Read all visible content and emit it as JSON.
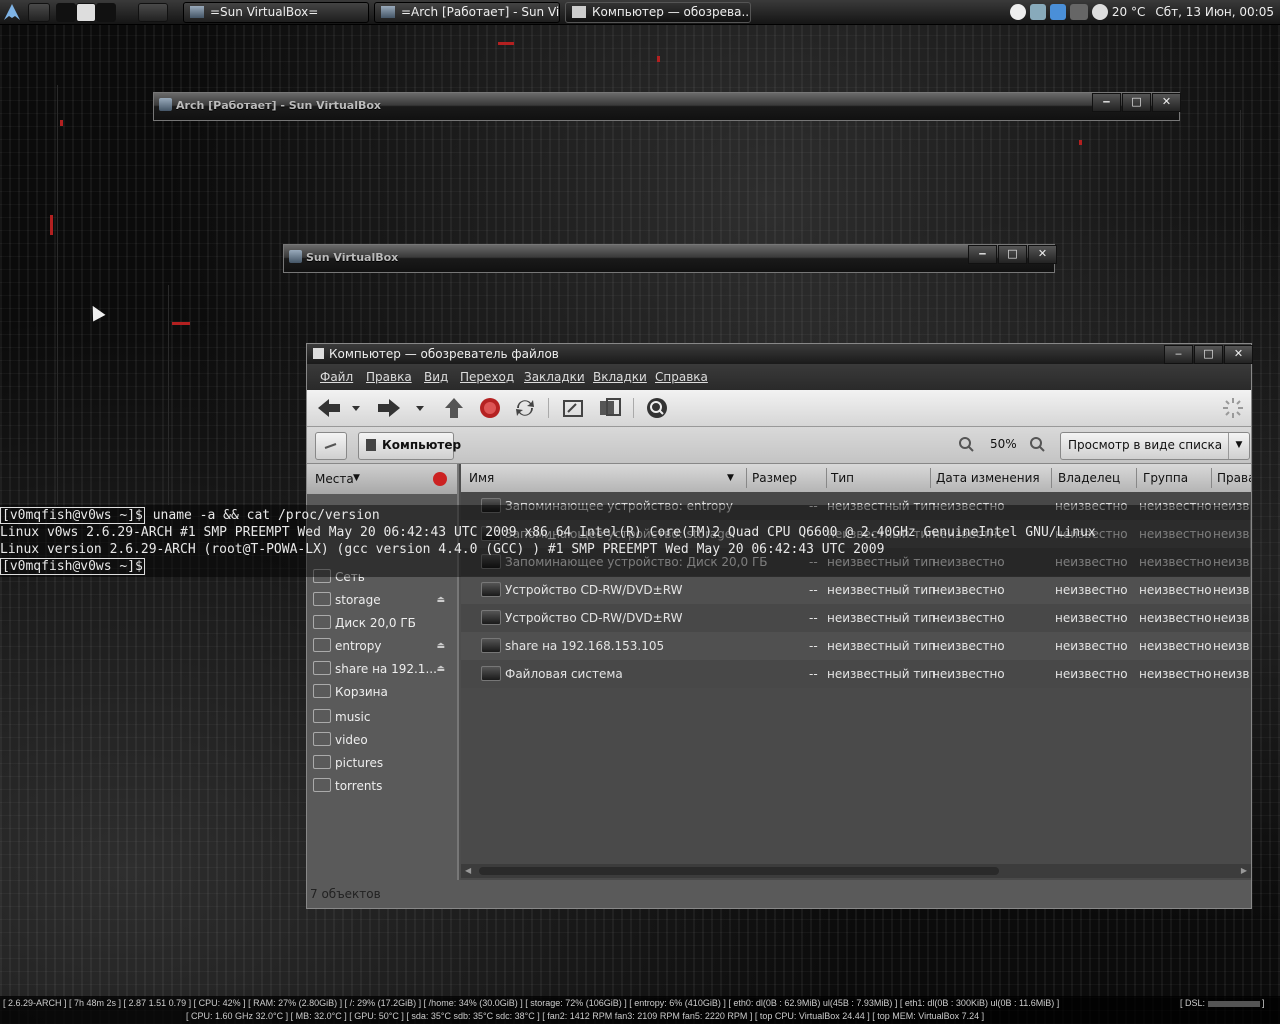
{
  "top_panel": {
    "tasks": [
      {
        "label": "=Sun VirtualBox="
      },
      {
        "label": "=Arch [Работает] - Sun Vi..."
      },
      {
        "label": "Компьютер — обозрева..."
      }
    ],
    "tray": {
      "temp": "20 °C",
      "clock": "Сбт, 13 Июн, 00:05"
    }
  },
  "shaded_windows": [
    {
      "title": "Arch [Работает] - Sun VirtualBox"
    },
    {
      "title": "Sun VirtualBox"
    }
  ],
  "window_controls": {
    "minimize": "‒",
    "maximize": "□",
    "close": "✕"
  },
  "file_manager": {
    "title": "Компьютер — обозреватель файлов",
    "menu": [
      "Файл",
      "Правка",
      "Вид",
      "Переход",
      "Закладки",
      "Вкладки",
      "Справка"
    ],
    "location_button": "Компьютер",
    "zoom": "50%",
    "view_mode": "Просмотр в виде списка",
    "sidebar_header": "Места",
    "sidebar_items": [
      {
        "label": "Сеть",
        "icon": "network-icon",
        "eject": false
      },
      {
        "label": "storage",
        "icon": "drive-icon",
        "eject": true
      },
      {
        "label": "Диск 20,0 ГБ",
        "icon": "drive-icon",
        "eject": false
      },
      {
        "label": "entropy",
        "icon": "drive-icon",
        "eject": true
      },
      {
        "label": "share на 192.1...",
        "icon": "network-share-icon",
        "eject": true
      },
      {
        "label": "Корзина",
        "icon": "trash-icon",
        "eject": false
      },
      {
        "label": "music",
        "icon": "folder-icon",
        "eject": false
      },
      {
        "label": "video",
        "icon": "folder-icon",
        "eject": false
      },
      {
        "label": "pictures",
        "icon": "folder-icon",
        "eject": false
      },
      {
        "label": "torrents",
        "icon": "folder-icon",
        "eject": false
      }
    ],
    "columns": [
      "Имя",
      "Размер",
      "Тип",
      "Дата изменения",
      "Владелец",
      "Группа",
      "Права"
    ],
    "rows": [
      {
        "name": "Запоминающее устройство: entropy",
        "size": "--",
        "type": "неизвестный тип",
        "date": "неизвестно",
        "owner": "неизвестно",
        "group": "неизвестно",
        "perms": "неизв"
      },
      {
        "name": "Запоминающее устройство: storage",
        "size": "--",
        "type": "неизвестный тип",
        "date": "неизвестно",
        "owner": "неизвестно",
        "group": "неизвестно",
        "perms": "неизв"
      },
      {
        "name": "Запоминающее устройство: Диск 20,0 ГБ",
        "size": "--",
        "type": "неизвестный тип",
        "date": "неизвестно",
        "owner": "неизвестно",
        "group": "неизвестно",
        "perms": "неизв"
      },
      {
        "name": "Устройство CD-RW/DVD±RW",
        "size": "--",
        "type": "неизвестный тип",
        "date": "неизвестно",
        "owner": "неизвестно",
        "group": "неизвестно",
        "perms": "неизв"
      },
      {
        "name": "Устройство CD-RW/DVD±RW",
        "size": "--",
        "type": "неизвестный тип",
        "date": "неизвестно",
        "owner": "неизвестно",
        "group": "неизвестно",
        "perms": "неизв"
      },
      {
        "name": "share на 192.168.153.105",
        "size": "--",
        "type": "неизвестный тип",
        "date": "неизвестно",
        "owner": "неизвестно",
        "group": "неизвестно",
        "perms": "неизв"
      },
      {
        "name": "Файловая система",
        "size": "--",
        "type": "неизвестный тип",
        "date": "неизвестно",
        "owner": "неизвестно",
        "group": "неизвестно",
        "perms": "неизв"
      }
    ],
    "status": "7 объектов"
  },
  "terminal": {
    "prompt1": "[v0mqfish@v0ws ~]$",
    "command": " uname -a && cat /proc/version",
    "out1": "Linux v0ws 2.6.29-ARCH #1 SMP PREEMPT Wed May 20 06:42:43 UTC 2009 x86_64 Intel(R) Core(TM)2 Quad CPU Q6600 @ 2.40GHz GenuineIntel GNU/Linux",
    "out2": "Linux version 2.6.29-ARCH (root@T-POWA-LX) (gcc version 4.4.0 (GCC) ) #1 SMP PREEMPT Wed May 20 06:42:43 UTC 2009",
    "prompt2": "[v0mqfish@v0ws ~]$"
  },
  "status_bar": {
    "line1": "[ 2.6.29-ARCH ] [ 7h 48m 2s ] [ 2.87 1.51 0.79 ] [ CPU: 42% ] [ RAM: 27% (2.80GiB) ] [ /: 29% (17.2GiB) ] [ /home: 34% (30.0GiB) ] [ storage: 72% (106GiB) ] [ entropy: 6% (410GiB) ] [ eth0: dl(0B : 62.9MiB) ul(45B : 7.93MiB) ] [ eth1: dl(0B : 300KiB) ul(0B : 11.6MiB) ]",
    "line2": "[ CPU: 1.60 GHz 32.0°C ] [ MB: 32.0°C ] [ GPU: 50°C ] [ sda: 35°C sdb: 35°C sdc: 38°C ] [ fan2: 1412 RPM  fan3: 2109 RPM  fan5: 2220 RPM ] [ top CPU: VirtualBox     24.44 ] [ top MEM: VirtualBox     7.24 ]",
    "dsl": "[ DSL:",
    "dsl_end": "]"
  }
}
